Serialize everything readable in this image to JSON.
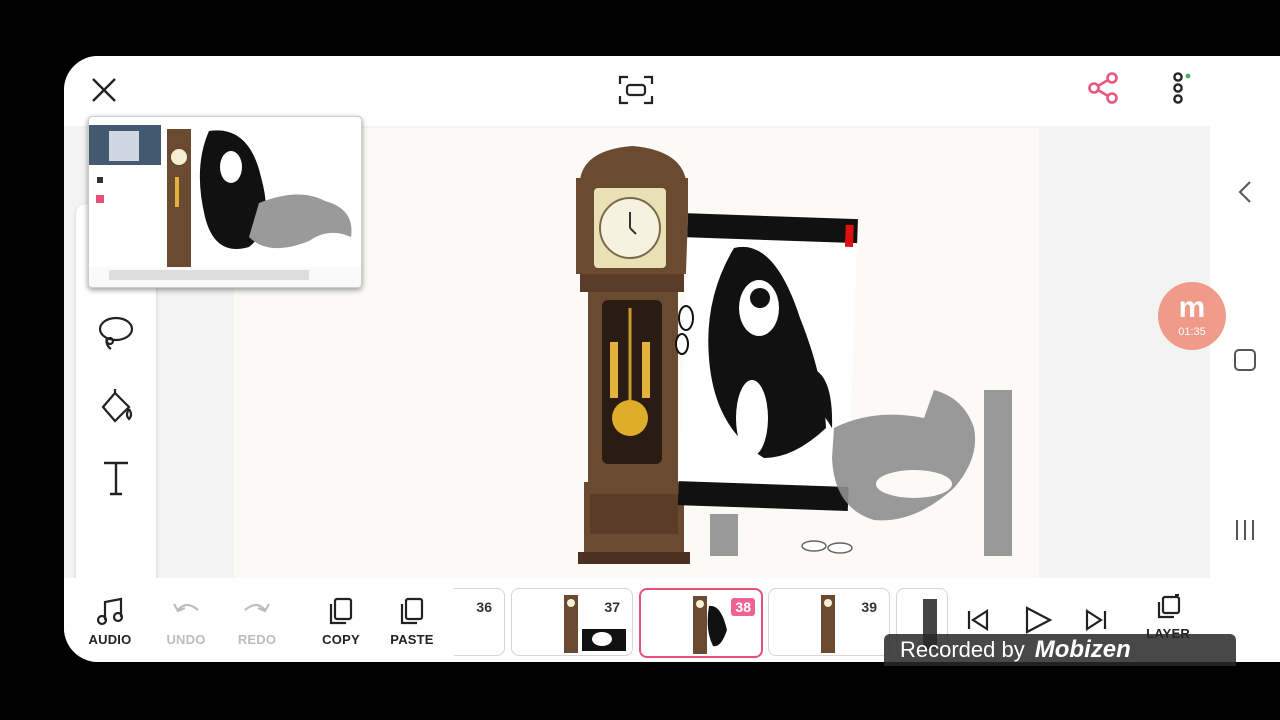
{
  "colors": {
    "accent": "#e6507a",
    "share": "#e8587d",
    "clock_wood": "#6b4a32",
    "recorder": "#f0927e"
  },
  "icons": {
    "close": "close-icon",
    "fit_screen": "fit-screen-icon",
    "share": "share-icon",
    "more": "more-vertical-icon",
    "lasso": "lasso-icon",
    "fill": "fill-bucket-icon",
    "text": "text-tool-icon",
    "audio": "music-note-icon",
    "undo": "undo-icon",
    "redo": "redo-icon",
    "copy": "copy-icon",
    "paste": "paste-icon",
    "prev": "skip-previous-icon",
    "play": "play-icon",
    "next": "skip-next-icon",
    "layer": "layers-icon",
    "back": "chevron-left-icon",
    "home": "home-square-icon",
    "recent": "recent-apps-icon"
  },
  "toolbar": {
    "audio": "AUDIO",
    "undo": "UNDO",
    "redo": "REDO",
    "copy": "COPY",
    "paste": "PASTE",
    "layer": "LAYER"
  },
  "frames": [
    {
      "number": "36"
    },
    {
      "number": "37"
    },
    {
      "number": "38",
      "active": true
    },
    {
      "number": "39"
    }
  ],
  "recorder": {
    "logo": "m",
    "time": "01:35"
  },
  "watermark": {
    "text": "Recorded by",
    "brand": "Mobizen"
  }
}
